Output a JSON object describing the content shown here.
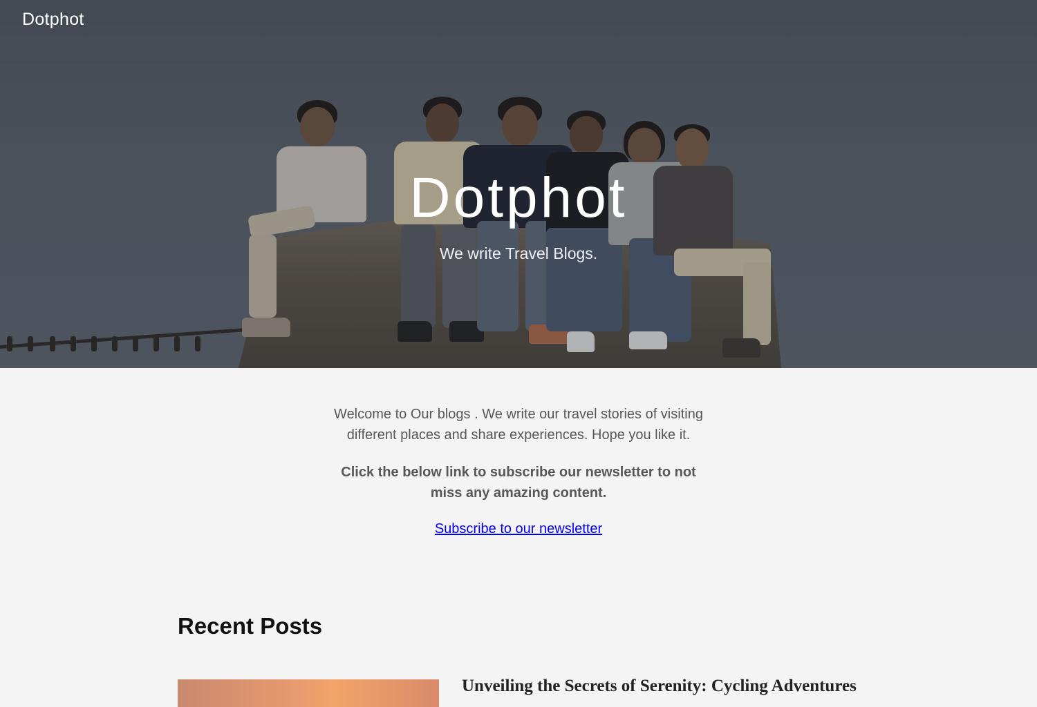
{
  "header": {
    "site_title": "Dotphot"
  },
  "hero": {
    "title": "Dotphot",
    "subtitle": "We write Travel Blogs."
  },
  "intro": {
    "welcome_text": "Welcome to Our blogs . We write our travel stories of visiting different places and share experiences. Hope you like it.",
    "cta_text": "Click the below link to subscribe our newsletter to not miss any amazing content.",
    "subscribe_link_label": "Subscribe to our newsletter"
  },
  "recent_posts": {
    "heading": "Recent Posts",
    "posts": [
      {
        "title": "Unveiling the Secrets of Serenity: Cycling Adventures"
      }
    ]
  },
  "colors": {
    "page_background": "#f4f4f4",
    "link": "#0000ee",
    "body_text": "#575757"
  }
}
